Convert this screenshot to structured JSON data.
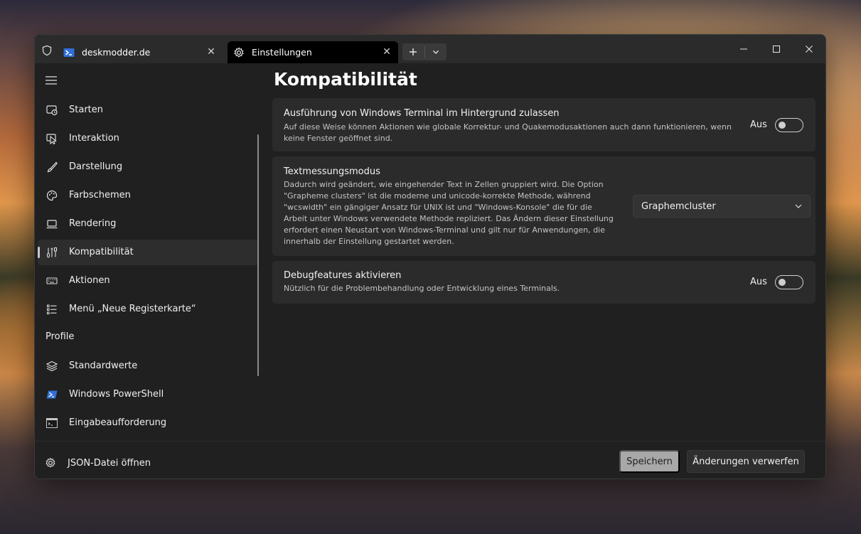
{
  "tabs": [
    {
      "title": "deskmodder.de",
      "icon": "powershell-icon",
      "close": "✕"
    },
    {
      "title": "Einstellungen",
      "icon": "gear-icon",
      "close": "✕"
    }
  ],
  "window_controls": {
    "minimize": "—",
    "maximize": "☐",
    "close": "✕"
  },
  "sidebar": {
    "items": [
      {
        "label": "Starten",
        "icon": "startup-icon"
      },
      {
        "label": "Interaktion",
        "icon": "interaction-icon"
      },
      {
        "label": "Darstellung",
        "icon": "brush-icon"
      },
      {
        "label": "Farbschemen",
        "icon": "palette-icon"
      },
      {
        "label": "Rendering",
        "icon": "monitor-icon"
      },
      {
        "label": "Kompatibilität",
        "icon": "compatibility-icon",
        "selected": true
      },
      {
        "label": "Aktionen",
        "icon": "keyboard-icon"
      },
      {
        "label": "Menü „Neue Registerkarte“",
        "icon": "list-icon"
      }
    ],
    "profiles_header": "Profile",
    "profiles": [
      {
        "label": "Standardwerte",
        "icon": "layers-icon"
      },
      {
        "label": "Windows PowerShell",
        "icon": "powershell-icon"
      },
      {
        "label": "Eingabeaufforderung",
        "icon": "cmd-icon"
      }
    ]
  },
  "footer": {
    "json_label": "JSON-Datei öffnen",
    "save_label": "Speichern",
    "discard_label": "Änderungen verwerfen"
  },
  "main": {
    "title": "Kompatibilität",
    "settings": [
      {
        "title": "Ausführung von Windows Terminal im Hintergrund zulassen",
        "desc": "Auf diese Weise können Aktionen wie globale Korrektur- und Quakemodusaktionen auch dann funktionieren, wenn keine Fenster geöffnet sind.",
        "state_label": "Aus"
      },
      {
        "title": "Textmessungsmodus",
        "desc": "Dadurch wird geändert, wie eingehender Text in Zellen gruppiert wird. Die Option \"Grapheme clusters\" ist die moderne und unicode-korrekte Methode, während \"wcswidth\" ein gängiger Ansatz für UNIX ist und \"Windows-Konsole\" die für die Arbeit unter Windows verwendete Methode repliziert. Das Ändern dieser Einstellung erfordert einen Neustart von Windows-Terminal und gilt nur für Anwendungen, die innerhalb der Einstellung gestartet werden.",
        "value": "Graphemcluster"
      },
      {
        "title": "Debugfeatures aktivieren",
        "desc": "Nützlich für die Problembehandlung oder Entwicklung eines Terminals.",
        "state_label": "Aus"
      }
    ]
  },
  "colors": {
    "accent_selected": "#2d2d2d",
    "window_bg": "#202020",
    "card_bg": "#2b2b2b"
  }
}
